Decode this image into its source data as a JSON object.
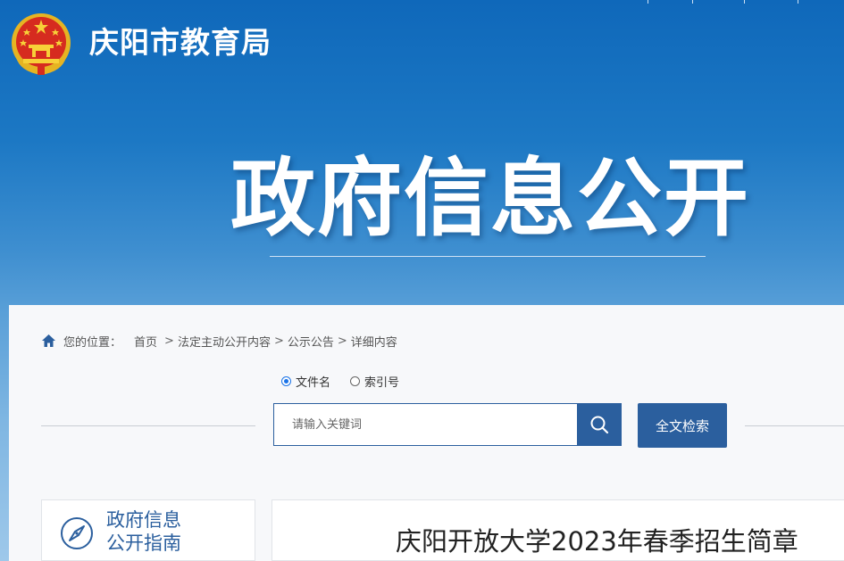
{
  "header": {
    "site_title": "庆阳市教育局",
    "hero_title": "政府信息公开",
    "emblem_icon": "national-emblem-icon"
  },
  "breadcrumb": {
    "label": "您的位置：",
    "items": [
      "首页",
      "法定主动公开内容",
      "公示公告",
      "详细内容"
    ],
    "separator": ">"
  },
  "search": {
    "options": [
      {
        "label": "文件名",
        "checked": true
      },
      {
        "label": "索引号",
        "checked": false
      }
    ],
    "placeholder": "请输入关键词",
    "fulltext_label": "全文检索"
  },
  "sidebar": {
    "guide_line1": "政府信息",
    "guide_line2": "公开指南"
  },
  "article": {
    "title": "庆阳开放大学2023年春季招生简章"
  },
  "colors": {
    "primary": "#2b5f9e",
    "banner_top": "#0f68ba"
  }
}
